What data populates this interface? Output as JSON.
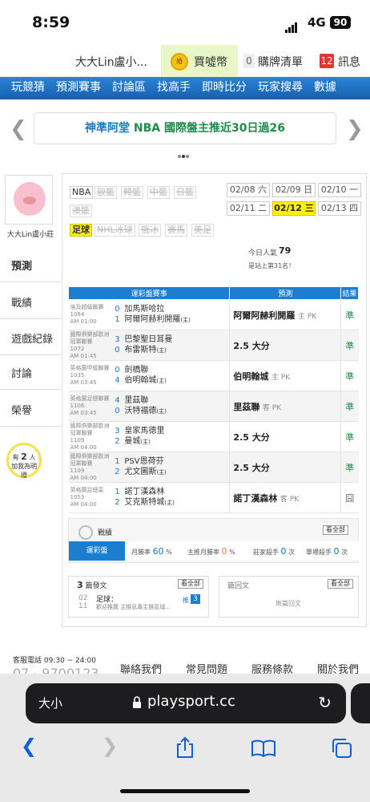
{
  "status": {
    "time": "8:59",
    "network": "4G",
    "battery": "90"
  },
  "topbar": {
    "username": "大大Lin盧小...",
    "coin_icon": "婚",
    "coin_label": "買噓幣",
    "cart_count": "0",
    "cart_label": "購牌清單",
    "msg_count": "12",
    "msg_label": "訊息"
  },
  "nav": {
    "items": [
      "玩競猜",
      "預測賽事",
      "討論區",
      "找高手",
      "即時比分",
      "玩家搜尋",
      "數據"
    ]
  },
  "banner": {
    "text1": "神準阿堂",
    "text2": "NBA 國際盤主推近30日過26"
  },
  "sidebar": {
    "username": "大大Lin盧小莊",
    "tabs": [
      "預測",
      "戰績",
      "遊戲紀錄",
      "討論",
      "榮譽"
    ],
    "online_prefix": "有",
    "online_count": "2",
    "online_unit": "人",
    "online_text": "加我為明燈"
  },
  "categories": {
    "row1": [
      "NBA",
      "歐籃",
      "韓籃",
      "中籃",
      "日籃"
    ],
    "row2": [
      "澳籃"
    ],
    "row3": [
      "足球",
      "NHL冰球",
      "俄冰",
      "賽馬",
      "美足"
    ]
  },
  "dates": [
    "02/08 六",
    "02/09 日",
    "02/10 一",
    "02/11 二",
    "02/12 三",
    "02/13 四"
  ],
  "popularity": {
    "label": "今日人氣",
    "value": "79",
    "rank_text": "是站上第31名！"
  },
  "table": {
    "headers": [
      "運彩盤賽事",
      "預測",
      "結果"
    ],
    "rows": [
      {
        "league": "埃及超級聯賽",
        "no": "1084",
        "time": "AM 01:00",
        "n1": "0",
        "t1": "加馬斯哈拉",
        "n2": "1",
        "t2": "阿爾阿赫利開羅",
        "t2s": "(主)",
        "pick": "阿爾阿赫利開羅",
        "pick_sub": "主 PK",
        "result": "準"
      },
      {
        "league": "國際俱樂部歐洲冠軍聯賽",
        "no": "1072",
        "time": "AM 01:45",
        "n1": "3",
        "t1": "巴黎聖日耳曼",
        "n2": "0",
        "t2": "布雷斯特",
        "t2s": "(主)",
        "pick": "2.5 大分",
        "pick_sub": "",
        "result": "準"
      },
      {
        "league": "英格蘭甲級聯賽",
        "no": "1035",
        "time": "AM 03:45",
        "n1": "0",
        "t1": "劍橋聯",
        "n2": "4",
        "t2": "伯明翰城",
        "t2s": "(主)",
        "pick": "伯明翰城",
        "pick_sub": "主 PK",
        "result": "準"
      },
      {
        "league": "英格蘭足總聯賽",
        "no": "1106",
        "time": "AM 03:45",
        "n1": "4",
        "t1": "里茲聯",
        "n2": "0",
        "t2": "沃特福德",
        "t2s": "(主)",
        "pick": "里茲聯",
        "pick_sub": "客 PK",
        "result": "準"
      },
      {
        "league": "國際俱樂部歐洲冠軍聯賽",
        "no": "1109",
        "time": "AM 04:00",
        "n1": "3",
        "t1": "皇家馬德里",
        "n2": "2",
        "t2": "曼城",
        "t2s": "(主)",
        "pick": "2.5 大分",
        "pick_sub": "",
        "result": "準"
      },
      {
        "league": "國際俱樂部歐洲冠軍聯賽",
        "no": "1109",
        "time": "AM 04:00",
        "n1": "1",
        "t1": "PSV恩荷芬",
        "n2": "2",
        "t2": "尤文圖斯",
        "t2s": "(主)",
        "pick": "2.5 大分",
        "pick_sub": "",
        "result": "準"
      },
      {
        "league": "英格蘭足總盃",
        "no": "1053",
        "time": "AM 04:00",
        "n1": "1",
        "t1": "諾丁漢森林",
        "n2": "2",
        "t2": "艾克斯特城",
        "t2s": "(主)",
        "pick": "諾丁漢森林",
        "pick_sub": "客 PK",
        "result": "囧"
      }
    ]
  },
  "stats": {
    "label": "戰績",
    "see_all": "看全部",
    "tab_label": "運彩盤",
    "month_label": "月勝率",
    "month_value": "60",
    "month_unit": "%",
    "main_label": "主推月勝率",
    "main_value": "0",
    "main_unit": "%",
    "kill_label": "莊家殺手",
    "kill_value": "0",
    "kill_unit": "次",
    "single_label": "單場殺手",
    "single_value": "0",
    "single_unit": "次"
  },
  "posts": {
    "count": "3",
    "label": "篇發文",
    "see_all": "看全部",
    "date_top": "02",
    "date_bottom": "11",
    "title": "足球：",
    "author": "歡迎推薦",
    "snippet": "主推息專主推區域...",
    "pushes_label": "推",
    "pushes": "3"
  },
  "replies": {
    "label": "篇回文",
    "see_all": "看全部",
    "empty": "無篇回文"
  },
  "footer": {
    "service": "客服電話 09:30 ~ 24:00",
    "phone": "07 - 9700123",
    "links": [
      "聯絡我們",
      "常見問題",
      "服務條款",
      "關於我們"
    ]
  },
  "browser": {
    "aa": "大小",
    "url": "playsport.cc"
  }
}
